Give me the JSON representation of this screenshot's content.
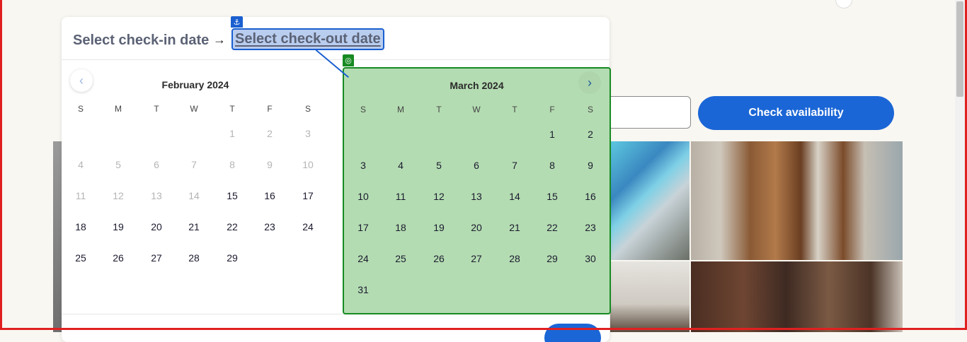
{
  "page": {
    "top_link": ""
  },
  "date_picker": {
    "checkin_label": "Select check-in date",
    "arrow": "→",
    "checkout_label": "Select check-out date",
    "prev_icon": "‹",
    "next_icon": "›",
    "anchor_icon": "⚓",
    "target_icon": "◎",
    "weekdays": [
      "S",
      "M",
      "T",
      "W",
      "T",
      "F",
      "S"
    ],
    "months": [
      {
        "title": "February 2024",
        "weeks": [
          [
            "",
            "",
            "",
            "",
            "1",
            "2",
            "3"
          ],
          [
            "4",
            "5",
            "6",
            "7",
            "8",
            "9",
            "10"
          ],
          [
            "11",
            "12",
            "13",
            "14",
            "15",
            "16",
            "17"
          ],
          [
            "18",
            "19",
            "20",
            "21",
            "22",
            "23",
            "24"
          ],
          [
            "25",
            "26",
            "27",
            "28",
            "29",
            "",
            ""
          ]
        ],
        "disabled_through": 14
      },
      {
        "title": "March 2024",
        "weeks": [
          [
            "",
            "",
            "",
            "",
            "",
            "1",
            "2"
          ],
          [
            "3",
            "4",
            "5",
            "6",
            "7",
            "8",
            "9"
          ],
          [
            "10",
            "11",
            "12",
            "13",
            "14",
            "15",
            "16"
          ],
          [
            "17",
            "18",
            "19",
            "20",
            "21",
            "22",
            "23"
          ],
          [
            "24",
            "25",
            "26",
            "27",
            "28",
            "29",
            "30"
          ],
          [
            "31",
            "",
            "",
            "",
            "",
            "",
            ""
          ]
        ],
        "disabled_through": 0
      }
    ]
  },
  "booking": {
    "check_button": "Check availability"
  },
  "colors": {
    "accent": "#1b66d6",
    "highlight": "#b4dcb2",
    "highlight_border": "#178a22"
  }
}
